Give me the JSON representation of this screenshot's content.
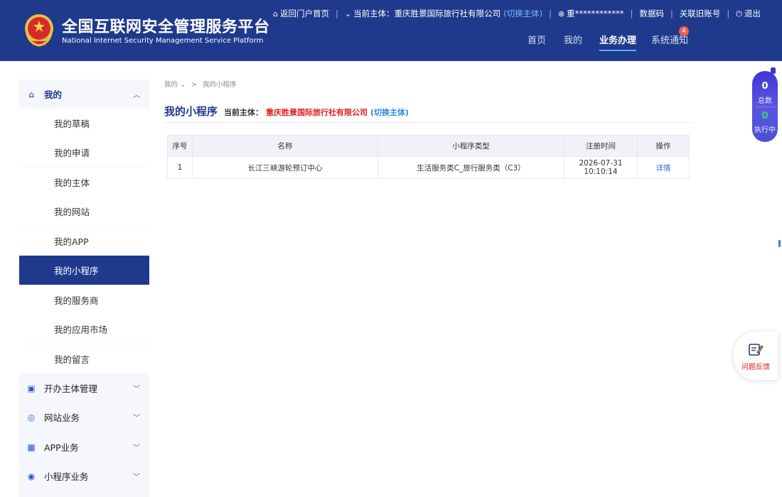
{
  "header": {
    "title_cn": "全国互联网安全管理服务平台",
    "title_en": "National Internet Security Management Service Platform",
    "topbar": {
      "home_link": "返回门户首页",
      "subject_label": "当前主体：",
      "subject_name": "重庆胜景国际旅行社有限公司",
      "switch_label": "(切换主体)",
      "user": "重************",
      "data_code": "数据码",
      "link_account": "关联旧账号",
      "logout": "退出"
    },
    "nav": [
      "首页",
      "我的",
      "业务办理",
      "系统通知"
    ],
    "active_nav": "业务办理",
    "notice_count": "4"
  },
  "sidebar": {
    "my_group": "我的",
    "sub_items": [
      "我的草稿",
      "我的申请",
      "我的主体",
      "我的网站",
      "我的APP",
      "我的小程序",
      "我的服务商",
      "我的应用市场",
      "我的留言"
    ],
    "active_item": "我的小程序",
    "groups": [
      "开办主体管理",
      "网站业务",
      "APP业务",
      "小程序业务"
    ]
  },
  "content": {
    "breadcrumb": [
      "我的",
      "我的小程序"
    ],
    "page_title": "我的小程序",
    "subject_label": "当前主体：",
    "subject_name": "重庆胜景国际旅行社有限公司",
    "switch_label": "(切换主体)",
    "table": {
      "columns": [
        "序号",
        "名称",
        "小程序类型",
        "注册时间",
        "操作"
      ],
      "rows": [
        {
          "index": "1",
          "name": "长江三峡游轮预订中心",
          "type": "生活服务类C_旅行服务类（C3）",
          "registered": "2026-07-31 10:10:14",
          "action": "详情"
        }
      ]
    }
  },
  "widgets": {
    "total_count": "0",
    "total_label": "总数",
    "running_count": "0",
    "running_label": "执行中",
    "feedback_label": "问题反馈"
  },
  "colors": {
    "header_bg": "#1f3a8c",
    "active_sidebar": "#1f3a8c",
    "accent_link": "#2a8ae0",
    "company_red": "#e02020"
  }
}
